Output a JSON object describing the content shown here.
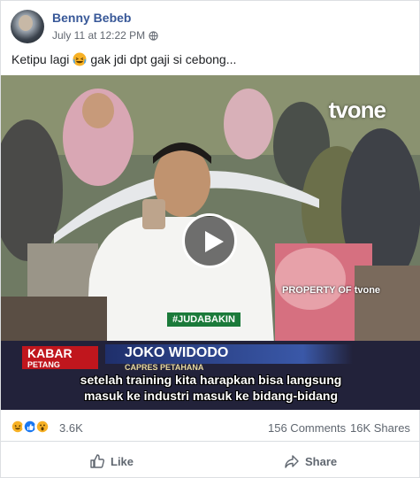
{
  "post": {
    "author": "Benny Bebeb",
    "timestamp": "July 11 at 12:22 PM",
    "privacy_icon": "globe-icon",
    "caption_before": "Ketipu lagi",
    "caption_emoji": "laughing-tears-emoji",
    "caption_after": "gak jdi dpt gaji si cebong..."
  },
  "video": {
    "channel_logo": "tvone",
    "watermark": "PROPERTY OF tvone",
    "hashtag": "#JUDABAKIN",
    "program_line1": "KABAR",
    "program_line2": "PETANG",
    "speaker_name": "JOKO WIDODO",
    "speaker_role": "CAPRES PETAHANA",
    "subtitle_line1": "setelah training kita harapkan bisa langsung",
    "subtitle_line2": "masuk ke industri masuk ke bidang-bidang",
    "play_icon": "play-icon"
  },
  "stats": {
    "reactions": [
      "haha",
      "like",
      "wow"
    ],
    "reaction_count": "3.6K",
    "comments": "156 Comments",
    "shares": "16K Shares"
  },
  "actions": {
    "like_label": "Like",
    "share_label": "Share"
  },
  "colors": {
    "author_link": "#385898",
    "meta_text": "#616770",
    "kabar_red": "#c0161d",
    "like_blue": "#1877f2",
    "haha_yellow": "#f7b125"
  }
}
